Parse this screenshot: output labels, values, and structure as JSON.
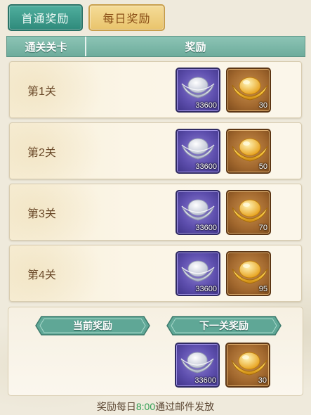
{
  "tabs": {
    "first_clear": "首通奖励",
    "daily": "每日奖励"
  },
  "table": {
    "col_stage": "通关关卡",
    "col_reward": "奖励"
  },
  "rows": [
    {
      "label": "第1关",
      "silver": "33600",
      "gold": "30"
    },
    {
      "label": "第2关",
      "silver": "33600",
      "gold": "50"
    },
    {
      "label": "第3关",
      "silver": "33600",
      "gold": "70"
    },
    {
      "label": "第4关",
      "silver": "33600",
      "gold": "95"
    }
  ],
  "panel": {
    "current_label": "当前奖励",
    "next_label": "下一关奖励",
    "current_silver": "33600",
    "current_gold": "30"
  },
  "footer": {
    "prefix": "奖励每日",
    "time": "8:00",
    "suffix": "通过邮件发放"
  },
  "icons": {
    "silver": "silver-ingot-icon",
    "gold": "gold-ingot-icon"
  },
  "colors": {
    "tab_active": "#3a9a8a",
    "tab_inactive": "#eccd7e",
    "header": "#7db7a8",
    "silver_slot": "#5e4fae",
    "gold_slot": "#a2682e",
    "time_text": "#2f9e52"
  }
}
